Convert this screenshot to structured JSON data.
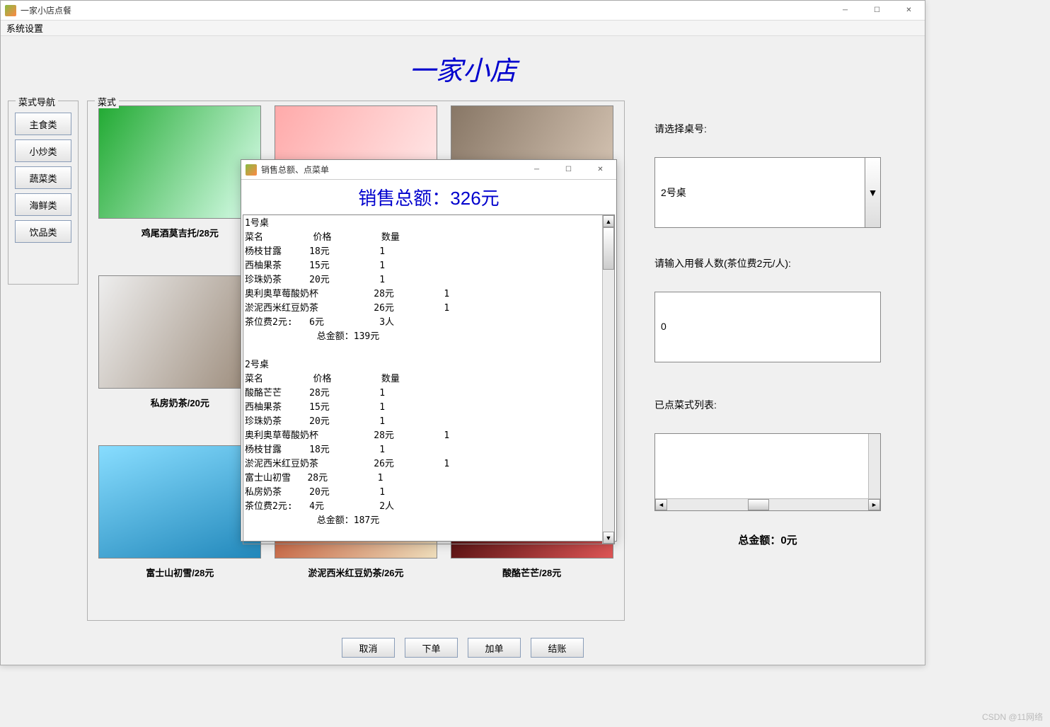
{
  "main_window": {
    "title": "一家小店点餐",
    "menu_item": "系统设置",
    "app_title": "一家小店",
    "nav": {
      "label": "菜式导航",
      "items": [
        "主食类",
        "小炒类",
        "蔬菜类",
        "海鲜类",
        "饮品类"
      ]
    },
    "menu": {
      "label": "菜式",
      "items": [
        {
          "caption": "鸡尾酒莫吉托/28元"
        },
        {
          "caption": ""
        },
        {
          "caption": ""
        },
        {
          "caption": "私房奶茶/20元"
        },
        {
          "caption": ""
        },
        {
          "caption": ""
        },
        {
          "caption": "富士山初雪/28元"
        },
        {
          "caption": "淤泥西米红豆奶茶/26元"
        },
        {
          "caption": "酸酪芒芒/28元"
        }
      ]
    },
    "right": {
      "label_table": "请选择桌号:",
      "combo_value": "2号桌",
      "label_people": "请输入用餐人数(茶位费2元/人):",
      "people_value": "0",
      "label_ordered": "已点菜式列表:",
      "total_label": "总金额：",
      "total_value": "0元"
    },
    "buttons": {
      "cancel": "取消",
      "order": "下单",
      "add": "加单",
      "checkout": "结账"
    }
  },
  "modal": {
    "title": "销售总额、点菜单",
    "sales_title": "销售总额：326元",
    "tables": [
      {
        "name": "1号桌",
        "header": {
          "c1": "菜名",
          "c2": "价格",
          "c3": "数量"
        },
        "rows": [
          {
            "c1": "杨枝甘露",
            "c2": "18元",
            "c3": "1"
          },
          {
            "c1": "西柚果茶",
            "c2": "15元",
            "c3": "1"
          },
          {
            "c1": "珍珠奶茶",
            "c2": "20元",
            "c3": "1"
          },
          {
            "c1": "奥利奥草莓酸奶杯",
            "c2": "28元",
            "c3": "1"
          },
          {
            "c1": "淤泥西米红豆奶茶",
            "c2": "26元",
            "c3": "1"
          },
          {
            "c1": "茶位费2元:",
            "c2": "6元",
            "c3": "3人"
          }
        ],
        "subtotal_label": "总金额：",
        "subtotal": "139元"
      },
      {
        "name": "2号桌",
        "header": {
          "c1": "菜名",
          "c2": "价格",
          "c3": "数量"
        },
        "rows": [
          {
            "c1": "酸酪芒芒",
            "c2": "28元",
            "c3": "1"
          },
          {
            "c1": "西柚果茶",
            "c2": "15元",
            "c3": "1"
          },
          {
            "c1": "珍珠奶茶",
            "c2": "20元",
            "c3": "1"
          },
          {
            "c1": "奥利奥草莓酸奶杯",
            "c2": "28元",
            "c3": "1"
          },
          {
            "c1": "杨枝甘露",
            "c2": "18元",
            "c3": "1"
          },
          {
            "c1": "淤泥西米红豆奶茶",
            "c2": "26元",
            "c3": "1"
          },
          {
            "c1": "富士山初雪",
            "c2": "28元",
            "c3": "1"
          },
          {
            "c1": "私房奶茶",
            "c2": "20元",
            "c3": "1"
          },
          {
            "c1": "茶位费2元:",
            "c2": "4元",
            "c3": "2人"
          }
        ],
        "subtotal_label": "总金额：",
        "subtotal": "187元"
      }
    ]
  },
  "watermark": "CSDN @11网络"
}
